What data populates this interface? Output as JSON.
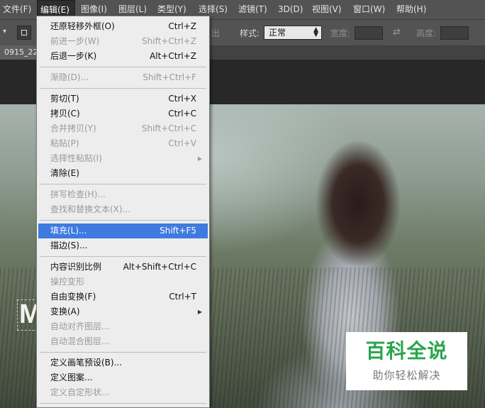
{
  "menubar": {
    "items": [
      {
        "label": "文件(F)"
      },
      {
        "label": "编辑(E)"
      },
      {
        "label": "图像(I)"
      },
      {
        "label": "图层(L)"
      },
      {
        "label": "类型(Y)"
      },
      {
        "label": "选择(S)"
      },
      {
        "label": "滤镜(T)"
      },
      {
        "label": "3D(D)"
      },
      {
        "label": "视图(V)"
      },
      {
        "label": "窗口(W)"
      },
      {
        "label": "帮助(H)"
      }
    ]
  },
  "options": {
    "partial_label": "出",
    "style_label": "样式:",
    "style_value": "正常",
    "width_label": "宽度:",
    "height_label": "高度:"
  },
  "document": {
    "tab_title": "0915_22"
  },
  "canvas": {
    "text_layer_char": "M"
  },
  "watermark": {
    "title": "百科全说",
    "subtitle": "助你轻松解决"
  },
  "edit_menu": {
    "items": [
      {
        "label": "还原轻移外框(O)",
        "shortcut": "Ctrl+Z"
      },
      {
        "label": "前进一步(W)",
        "shortcut": "Shift+Ctrl+Z"
      },
      {
        "label": "后退一步(K)",
        "shortcut": "Alt+Ctrl+Z"
      },
      {
        "label": "渐隐(D)...",
        "shortcut": "Shift+Ctrl+F"
      },
      {
        "label": "剪切(T)",
        "shortcut": "Ctrl+X"
      },
      {
        "label": "拷贝(C)",
        "shortcut": "Ctrl+C"
      },
      {
        "label": "合并拷贝(Y)",
        "shortcut": "Shift+Ctrl+C"
      },
      {
        "label": "粘贴(P)",
        "shortcut": "Ctrl+V"
      },
      {
        "label": "选择性粘贴(I)",
        "shortcut": ""
      },
      {
        "label": "清除(E)",
        "shortcut": ""
      },
      {
        "label": "拼写检查(H)...",
        "shortcut": ""
      },
      {
        "label": "查找和替换文本(X)...",
        "shortcut": ""
      },
      {
        "label": "填充(L)...",
        "shortcut": "Shift+F5"
      },
      {
        "label": "描边(S)...",
        "shortcut": ""
      },
      {
        "label": "内容识别比例",
        "shortcut": "Alt+Shift+Ctrl+C"
      },
      {
        "label": "操控变形",
        "shortcut": ""
      },
      {
        "label": "自由变换(F)",
        "shortcut": "Ctrl+T"
      },
      {
        "label": "变换(A)",
        "shortcut": ""
      },
      {
        "label": "自动对齐图层...",
        "shortcut": ""
      },
      {
        "label": "自动混合图层...",
        "shortcut": ""
      },
      {
        "label": "定义画笔预设(B)...",
        "shortcut": ""
      },
      {
        "label": "定义图案...",
        "shortcut": ""
      },
      {
        "label": "定义自定形状...",
        "shortcut": ""
      }
    ]
  }
}
